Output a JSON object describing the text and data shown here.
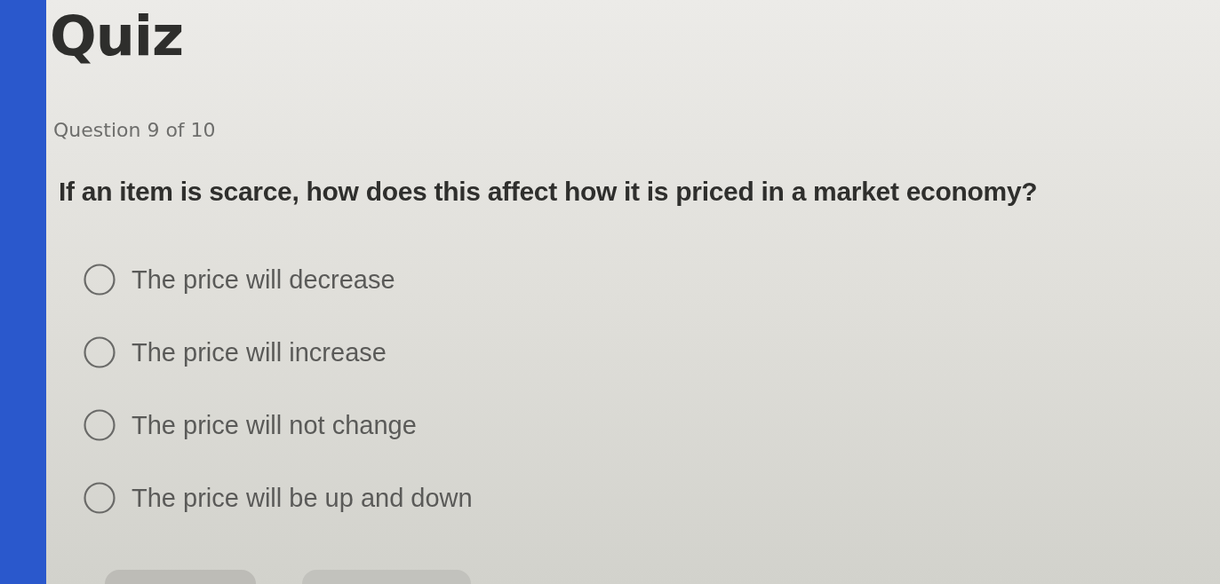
{
  "title": "Quiz",
  "progress": "Question 9 of 10",
  "question": "If an item is scarce, how does this affect how it is priced in a market economy?",
  "options": [
    {
      "label": "The price will decrease",
      "selected": false
    },
    {
      "label": "The price will increase",
      "selected": false
    },
    {
      "label": "The price will not change",
      "selected": false
    },
    {
      "label": "The price will be up and down",
      "selected": false
    }
  ],
  "buttons": [
    {
      "kind": "nav"
    },
    {
      "kind": "nav"
    }
  ]
}
